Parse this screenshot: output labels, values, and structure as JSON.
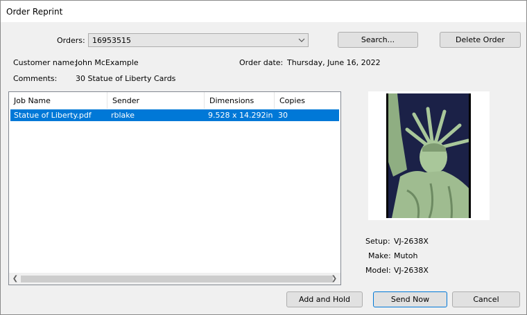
{
  "window": {
    "title": "Order Reprint"
  },
  "orders": {
    "label": "Orders:",
    "value": "16953515"
  },
  "buttons": {
    "search": "Search...",
    "delete_order": "Delete Order",
    "add_and_hold": "Add and Hold",
    "send_now": "Send Now",
    "cancel": "Cancel"
  },
  "customer": {
    "name_label": "Customer name:",
    "name": "John McExample",
    "order_date_label": "Order date:",
    "order_date": "Thursday, June 16, 2022",
    "comments_label": "Comments:",
    "comments": "30 Statue of Liberty Cards"
  },
  "jobs": {
    "columns": [
      "Job Name",
      "Sender",
      "Dimensions",
      "Copies"
    ],
    "rows": [
      {
        "job_name": "Statue of Liberty.pdf",
        "sender": "rblake",
        "dimensions": "9.528 x 14.292in",
        "copies": "30"
      }
    ]
  },
  "printer": {
    "setup_label": "Setup:",
    "setup": "VJ-2638X",
    "make_label": "Make:",
    "make": "Mutoh",
    "model_label": "Model:",
    "model": "VJ-2638X"
  },
  "colors": {
    "selection": "#0078d7",
    "sky": "#1b2147",
    "statue": "#a9c79a"
  }
}
